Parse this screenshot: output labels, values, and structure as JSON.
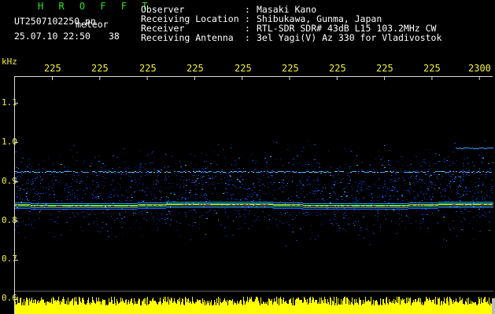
{
  "header": {
    "app_title": "H R O F F T",
    "file_name": "UT2507102250.pn",
    "mode": "meteor",
    "datetime": "25.07.10 22:50",
    "count": "38",
    "fields": [
      {
        "label": "Observer",
        "sep": ":",
        "value": "Masaki Kano"
      },
      {
        "label": "Receiving Location",
        "sep": ":",
        "value": "Shibukawa, Gunma, Japan"
      },
      {
        "label": "Receiver",
        "sep": ":",
        "value": "RTL-SDR SDR# 43dB L15 103.2MHz CW"
      },
      {
        "label": "Receiving Antenna",
        "sep": ":",
        "value": "3el Yagi(V) Az 330 for Vladivostok"
      }
    ]
  },
  "axes": {
    "y_unit": "kHz",
    "x_ticks": [
      "225",
      "225",
      "225",
      "225",
      "225",
      "225",
      "225",
      "225",
      "225",
      "2300"
    ],
    "y_ticks": [
      "1.1",
      "1.0",
      "0.9",
      "0.8",
      "0.7",
      "0.6"
    ]
  },
  "colors": {
    "background": "#000000",
    "header_title": "#27e327",
    "header_text": "#ffffff",
    "tick_labels": "#f2f23a",
    "trace_main": "#f0f000",
    "trace_hot": "#ff3000",
    "trace_secondary": "#3aa0ff",
    "noise_low": "#1030c0",
    "bottom_bar": "#ffff00"
  }
}
